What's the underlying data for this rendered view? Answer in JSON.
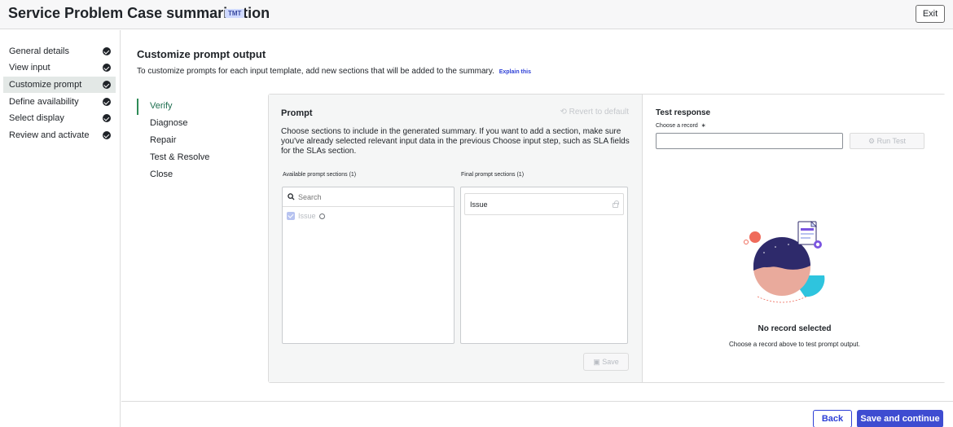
{
  "header": {
    "title": "Service Problem Case summarization",
    "tag": "TMT",
    "exit_label": "Exit"
  },
  "nav": {
    "items": [
      {
        "label": "General details",
        "completed": true
      },
      {
        "label": "View input",
        "completed": true
      },
      {
        "label": "Customize prompt",
        "completed": true,
        "active": true
      },
      {
        "label": "Define availability",
        "completed": true
      },
      {
        "label": "Select display",
        "completed": true
      },
      {
        "label": "Review and activate",
        "completed": true
      }
    ]
  },
  "main": {
    "title": "Customize prompt output",
    "description": "To customize prompts for each input template, add new sections that will be added to the summary.",
    "explain_link": "Explain this",
    "steps": [
      "Verify",
      "Diagnose",
      "Repair",
      "Test & Resolve",
      "Close"
    ],
    "active_step": "Verify"
  },
  "prompt": {
    "title": "Prompt",
    "revert_label": "Revert to default",
    "description": "Choose sections to include in the generated summary. If you want to add a section, make sure you've already selected relevant input data in the previous Choose input step, such as SLA fields for the SLAs section.",
    "available_label": "Available prompt sections (1)",
    "final_label": "Final prompt sections (1)",
    "search_placeholder": "Search",
    "available_items": [
      "Issue"
    ],
    "final_items": [
      "Issue"
    ],
    "save_label": "Save"
  },
  "test": {
    "title": "Test response",
    "record_label": "Choose a record",
    "required_mark": "∗",
    "record_value": "",
    "run_label": "Run Test",
    "empty_title": "No record selected",
    "empty_desc": "Choose a record above to test prompt output."
  },
  "footer": {
    "back_label": "Back",
    "continue_label": "Save and continue"
  },
  "colors": {
    "accent": "#3e4cd1",
    "active_step": "#2e8b57",
    "illustration_navy": "#2e2a6b",
    "illustration_pink": "#e9aa9c",
    "illustration_cyan": "#2ec4de",
    "illustration_coral": "#ef6b5b",
    "illustration_purple": "#7a54e0"
  }
}
